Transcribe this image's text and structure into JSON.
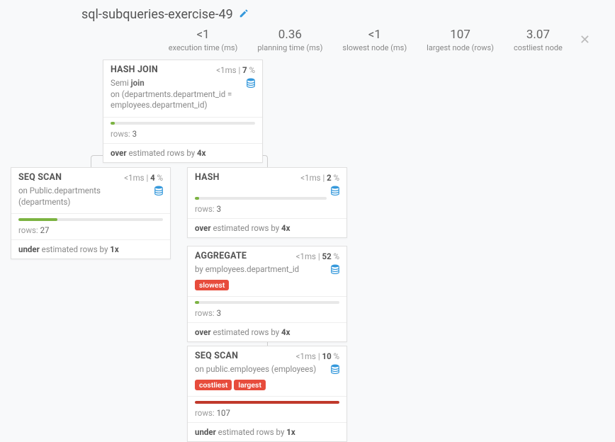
{
  "title": "sql-subqueries-exercise-49",
  "stats": [
    {
      "value": "<1",
      "label": "execution time (ms)"
    },
    {
      "value": "0.36",
      "label": "planning time (ms)"
    },
    {
      "value": "<1",
      "label": "slowest node (ms)"
    },
    {
      "value": "107",
      "label": "largest node (rows)"
    },
    {
      "value": "3.07",
      "label": "costliest node"
    }
  ],
  "nodes": {
    "hashJoin": {
      "name": "HASH JOIN",
      "time": "<1",
      "pct": "7",
      "bodyPrefix": "Semi ",
      "bodyJoin": "join",
      "bodyCond": "on (departments.department_id = employees.department_id)",
      "rows": "3",
      "estWord": "over",
      "estMid": " estimated rows by ",
      "estFactor": "4x",
      "barPct": 3,
      "barClass": "bar-green"
    },
    "seqDept": {
      "name": "SEQ SCAN",
      "time": "<1",
      "pct": "4",
      "bodyOn": "on ",
      "bodyRest": "Public.departments (departments)",
      "rows": "27",
      "estWord": "under",
      "estMid": " estimated rows by ",
      "estFactor": "1x",
      "barPct": 27,
      "barClass": "bar-green"
    },
    "hash": {
      "name": "HASH",
      "time": "<1",
      "pct": "2",
      "rows": "3",
      "estWord": "over",
      "estMid": " estimated rows by ",
      "estFactor": "4x",
      "barPct": 3,
      "barClass": "bar-green"
    },
    "aggregate": {
      "name": "AGGREGATE",
      "time": "<1",
      "pct": "52",
      "bodyBy": "by ",
      "bodyRest": "employees.department_id",
      "badges": [
        "slowest"
      ],
      "rows": "3",
      "estWord": "over",
      "estMid": " estimated rows by ",
      "estFactor": "4x",
      "barPct": 3,
      "barClass": "bar-green"
    },
    "seqEmp": {
      "name": "SEQ SCAN",
      "time": "<1",
      "pct": "10",
      "bodyOn": "on ",
      "bodyRest": "public.employees (employees)",
      "badges": [
        "costliest",
        "largest"
      ],
      "rows": "107",
      "estWord": "under",
      "estMid": " estimated rows by ",
      "estFactor": "1x",
      "barPct": 100,
      "barClass": "bar-red"
    }
  },
  "labels": {
    "rows": "rows: ",
    "ms": "ms",
    "sep": " | ",
    "pctSuffix": " %"
  },
  "colors": {
    "dbIcon": "#3498db"
  }
}
